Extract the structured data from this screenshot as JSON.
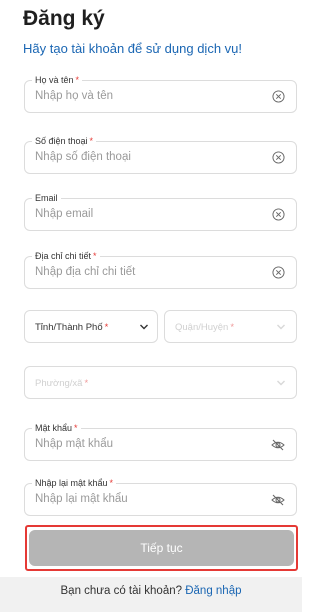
{
  "header": {
    "title": "Đăng ký",
    "subtitle": "Hãy tạo tài khoản để sử dụng dịch vụ!"
  },
  "form": {
    "full_name": {
      "label": "Họ và tên",
      "required_mark": "*",
      "placeholder": "Nhập họ và tên"
    },
    "phone": {
      "label": "Số điện thoại",
      "required_mark": "*",
      "placeholder": "Nhập số điện thoại"
    },
    "email": {
      "label": "Email",
      "placeholder": "Nhập email"
    },
    "address": {
      "label": "Địa chỉ chi tiết",
      "required_mark": "*",
      "placeholder": "Nhập địa chỉ chi tiết"
    },
    "province": {
      "value": "Tỉnh/Thành Phố",
      "required_mark": "*"
    },
    "district": {
      "value": "Quận/Huyện",
      "required_mark": "*"
    },
    "ward": {
      "value": "Phường/xã",
      "required_mark": "*"
    },
    "password": {
      "label": "Mật khẩu",
      "required_mark": "*",
      "placeholder": "Nhập mật khẩu"
    },
    "confirm_password": {
      "label": "Nhập lại mật khẩu",
      "required_mark": "*",
      "placeholder": "Nhập lại mật khẩu"
    }
  },
  "actions": {
    "continue_label": "Tiếp tục"
  },
  "footer": {
    "prompt": "Bạn chưa có tài khoản?",
    "login_link": "Đăng nhập"
  },
  "colors": {
    "accent": "#1a66b3",
    "required": "#e53935",
    "button_disabled": "#b5b5b5",
    "highlight_border": "#e53935"
  }
}
